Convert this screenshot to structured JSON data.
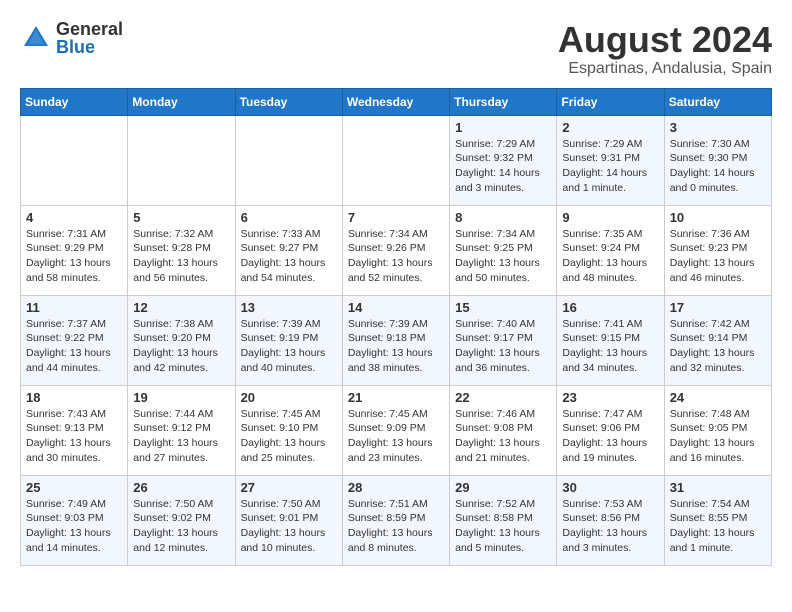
{
  "logo": {
    "general": "General",
    "blue": "Blue"
  },
  "title": {
    "month_year": "August 2024",
    "location": "Espartinas, Andalusia, Spain"
  },
  "days_of_week": [
    "Sunday",
    "Monday",
    "Tuesday",
    "Wednesday",
    "Thursday",
    "Friday",
    "Saturday"
  ],
  "weeks": [
    [
      {
        "day": "",
        "content": ""
      },
      {
        "day": "",
        "content": ""
      },
      {
        "day": "",
        "content": ""
      },
      {
        "day": "",
        "content": ""
      },
      {
        "day": "1",
        "content": "Sunrise: 7:29 AM\nSunset: 9:32 PM\nDaylight: 14 hours\nand 3 minutes."
      },
      {
        "day": "2",
        "content": "Sunrise: 7:29 AM\nSunset: 9:31 PM\nDaylight: 14 hours\nand 1 minute."
      },
      {
        "day": "3",
        "content": "Sunrise: 7:30 AM\nSunset: 9:30 PM\nDaylight: 14 hours\nand 0 minutes."
      }
    ],
    [
      {
        "day": "4",
        "content": "Sunrise: 7:31 AM\nSunset: 9:29 PM\nDaylight: 13 hours\nand 58 minutes."
      },
      {
        "day": "5",
        "content": "Sunrise: 7:32 AM\nSunset: 9:28 PM\nDaylight: 13 hours\nand 56 minutes."
      },
      {
        "day": "6",
        "content": "Sunrise: 7:33 AM\nSunset: 9:27 PM\nDaylight: 13 hours\nand 54 minutes."
      },
      {
        "day": "7",
        "content": "Sunrise: 7:34 AM\nSunset: 9:26 PM\nDaylight: 13 hours\nand 52 minutes."
      },
      {
        "day": "8",
        "content": "Sunrise: 7:34 AM\nSunset: 9:25 PM\nDaylight: 13 hours\nand 50 minutes."
      },
      {
        "day": "9",
        "content": "Sunrise: 7:35 AM\nSunset: 9:24 PM\nDaylight: 13 hours\nand 48 minutes."
      },
      {
        "day": "10",
        "content": "Sunrise: 7:36 AM\nSunset: 9:23 PM\nDaylight: 13 hours\nand 46 minutes."
      }
    ],
    [
      {
        "day": "11",
        "content": "Sunrise: 7:37 AM\nSunset: 9:22 PM\nDaylight: 13 hours\nand 44 minutes."
      },
      {
        "day": "12",
        "content": "Sunrise: 7:38 AM\nSunset: 9:20 PM\nDaylight: 13 hours\nand 42 minutes."
      },
      {
        "day": "13",
        "content": "Sunrise: 7:39 AM\nSunset: 9:19 PM\nDaylight: 13 hours\nand 40 minutes."
      },
      {
        "day": "14",
        "content": "Sunrise: 7:39 AM\nSunset: 9:18 PM\nDaylight: 13 hours\nand 38 minutes."
      },
      {
        "day": "15",
        "content": "Sunrise: 7:40 AM\nSunset: 9:17 PM\nDaylight: 13 hours\nand 36 minutes."
      },
      {
        "day": "16",
        "content": "Sunrise: 7:41 AM\nSunset: 9:15 PM\nDaylight: 13 hours\nand 34 minutes."
      },
      {
        "day": "17",
        "content": "Sunrise: 7:42 AM\nSunset: 9:14 PM\nDaylight: 13 hours\nand 32 minutes."
      }
    ],
    [
      {
        "day": "18",
        "content": "Sunrise: 7:43 AM\nSunset: 9:13 PM\nDaylight: 13 hours\nand 30 minutes."
      },
      {
        "day": "19",
        "content": "Sunrise: 7:44 AM\nSunset: 9:12 PM\nDaylight: 13 hours\nand 27 minutes."
      },
      {
        "day": "20",
        "content": "Sunrise: 7:45 AM\nSunset: 9:10 PM\nDaylight: 13 hours\nand 25 minutes."
      },
      {
        "day": "21",
        "content": "Sunrise: 7:45 AM\nSunset: 9:09 PM\nDaylight: 13 hours\nand 23 minutes."
      },
      {
        "day": "22",
        "content": "Sunrise: 7:46 AM\nSunset: 9:08 PM\nDaylight: 13 hours\nand 21 minutes."
      },
      {
        "day": "23",
        "content": "Sunrise: 7:47 AM\nSunset: 9:06 PM\nDaylight: 13 hours\nand 19 minutes."
      },
      {
        "day": "24",
        "content": "Sunrise: 7:48 AM\nSunset: 9:05 PM\nDaylight: 13 hours\nand 16 minutes."
      }
    ],
    [
      {
        "day": "25",
        "content": "Sunrise: 7:49 AM\nSunset: 9:03 PM\nDaylight: 13 hours\nand 14 minutes."
      },
      {
        "day": "26",
        "content": "Sunrise: 7:50 AM\nSunset: 9:02 PM\nDaylight: 13 hours\nand 12 minutes."
      },
      {
        "day": "27",
        "content": "Sunrise: 7:50 AM\nSunset: 9:01 PM\nDaylight: 13 hours\nand 10 minutes."
      },
      {
        "day": "28",
        "content": "Sunrise: 7:51 AM\nSunset: 8:59 PM\nDaylight: 13 hours\nand 8 minutes."
      },
      {
        "day": "29",
        "content": "Sunrise: 7:52 AM\nSunset: 8:58 PM\nDaylight: 13 hours\nand 5 minutes."
      },
      {
        "day": "30",
        "content": "Sunrise: 7:53 AM\nSunset: 8:56 PM\nDaylight: 13 hours\nand 3 minutes."
      },
      {
        "day": "31",
        "content": "Sunrise: 7:54 AM\nSunset: 8:55 PM\nDaylight: 13 hours\nand 1 minute."
      }
    ]
  ]
}
